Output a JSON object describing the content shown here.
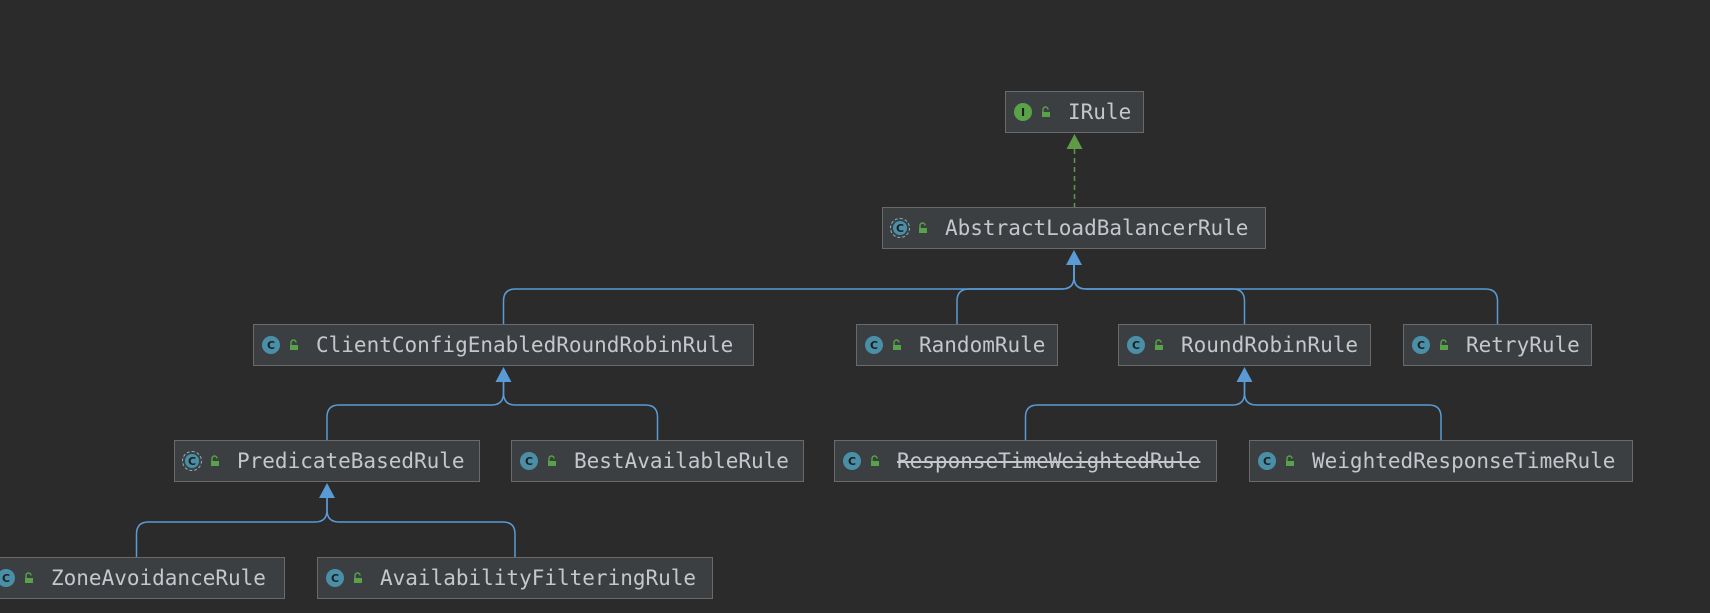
{
  "diagram": {
    "nodes": [
      {
        "id": "IRule",
        "label": "IRule",
        "kind": "interface",
        "kind_letter": "I",
        "deprecated": false
      },
      {
        "id": "AbstractLoadBalancerRule",
        "label": "AbstractLoadBalancerRule",
        "kind": "abstract",
        "kind_letter": "C",
        "deprecated": false
      },
      {
        "id": "ClientConfigEnabledRoundRobinRule",
        "label": "ClientConfigEnabledRoundRobinRule",
        "kind": "class",
        "kind_letter": "C",
        "deprecated": false
      },
      {
        "id": "RandomRule",
        "label": "RandomRule",
        "kind": "class",
        "kind_letter": "C",
        "deprecated": false
      },
      {
        "id": "RoundRobinRule",
        "label": "RoundRobinRule",
        "kind": "class",
        "kind_letter": "C",
        "deprecated": false
      },
      {
        "id": "RetryRule",
        "label": "RetryRule",
        "kind": "class",
        "kind_letter": "C",
        "deprecated": false
      },
      {
        "id": "PredicateBasedRule",
        "label": "PredicateBasedRule",
        "kind": "abstract",
        "kind_letter": "C",
        "deprecated": false
      },
      {
        "id": "BestAvailableRule",
        "label": "BestAvailableRule",
        "kind": "class",
        "kind_letter": "C",
        "deprecated": false
      },
      {
        "id": "ResponseTimeWeightedRule",
        "label": "ResponseTimeWeightedRule",
        "kind": "class",
        "kind_letter": "C",
        "deprecated": true
      },
      {
        "id": "WeightedResponseTimeRule",
        "label": "WeightedResponseTimeRule",
        "kind": "class",
        "kind_letter": "C",
        "deprecated": false
      },
      {
        "id": "ZoneAvoidanceRule",
        "label": "ZoneAvoidanceRule",
        "kind": "class",
        "kind_letter": "C",
        "deprecated": false
      },
      {
        "id": "AvailabilityFilteringRule",
        "label": "AvailabilityFilteringRule",
        "kind": "class",
        "kind_letter": "C",
        "deprecated": false
      }
    ],
    "edges": [
      {
        "from": "AbstractLoadBalancerRule",
        "to": "IRule",
        "type": "implements"
      },
      {
        "from": "ClientConfigEnabledRoundRobinRule",
        "to": "AbstractLoadBalancerRule",
        "type": "extends"
      },
      {
        "from": "RandomRule",
        "to": "AbstractLoadBalancerRule",
        "type": "extends"
      },
      {
        "from": "RoundRobinRule",
        "to": "AbstractLoadBalancerRule",
        "type": "extends"
      },
      {
        "from": "RetryRule",
        "to": "AbstractLoadBalancerRule",
        "type": "extends"
      },
      {
        "from": "PredicateBasedRule",
        "to": "ClientConfigEnabledRoundRobinRule",
        "type": "extends"
      },
      {
        "from": "BestAvailableRule",
        "to": "ClientConfigEnabledRoundRobinRule",
        "type": "extends"
      },
      {
        "from": "ResponseTimeWeightedRule",
        "to": "RoundRobinRule",
        "type": "extends"
      },
      {
        "from": "WeightedResponseTimeRule",
        "to": "RoundRobinRule",
        "type": "extends"
      },
      {
        "from": "ZoneAvoidanceRule",
        "to": "PredicateBasedRule",
        "type": "extends"
      },
      {
        "from": "AvailabilityFilteringRule",
        "to": "PredicateBasedRule",
        "type": "extends"
      }
    ]
  },
  "colors": {
    "background": "#2b2b2b",
    "node_fill": "#3c3f41",
    "node_border": "#6a6a6a",
    "text": "#c4c8cc",
    "extends_edge": "#5b9bd5",
    "implements_edge": "#5f9a47",
    "lock_icon": "#59a24a"
  },
  "icons": {
    "class": "class-icon",
    "interface": "interface-icon",
    "abstract": "abstract-class-icon",
    "visibility": "public-lock-icon"
  }
}
